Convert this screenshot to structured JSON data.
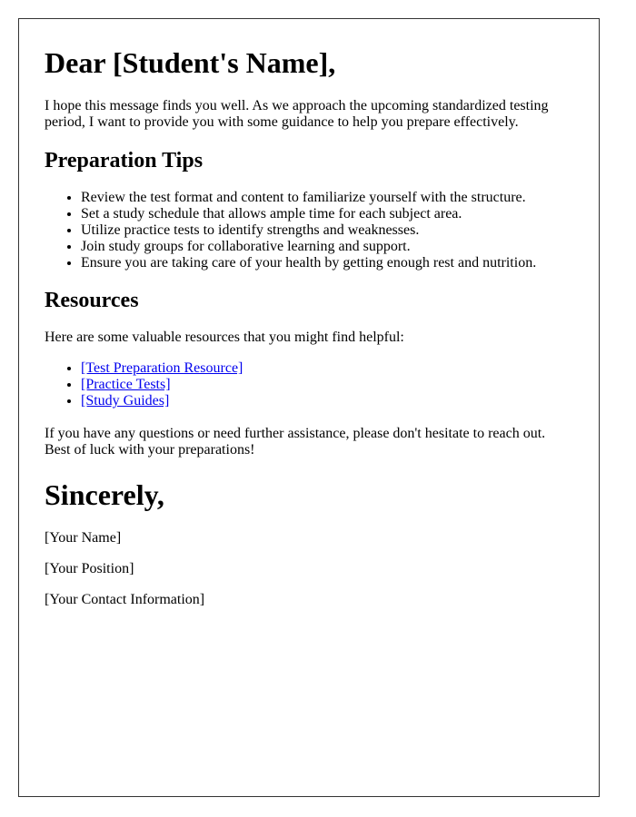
{
  "letter": {
    "greeting": "Dear [Student's Name],",
    "intro": "I hope this message finds you well. As we approach the upcoming standardized testing period, I want to provide you with some guidance to help you prepare effectively.",
    "tips_heading": "Preparation Tips",
    "tips": [
      "Review the test format and content to familiarize yourself with the structure.",
      "Set a study schedule that allows ample time for each subject area.",
      "Utilize practice tests to identify strengths and weaknesses.",
      "Join study groups for collaborative learning and support.",
      "Ensure you are taking care of your health by getting enough rest and nutrition."
    ],
    "resources_heading": "Resources",
    "resources_intro": "Here are some valuable resources that you might find helpful:",
    "resources": [
      "[Test Preparation Resource]",
      "[Practice Tests]",
      "[Study Guides]"
    ],
    "closing_paragraph": "If you have any questions or need further assistance, please don't hesitate to reach out. Best of luck with your preparations!",
    "sign_off": "Sincerely,",
    "signature": {
      "name": "[Your Name]",
      "position": "[Your Position]",
      "contact": "[Your Contact Information]"
    }
  },
  "colors": {
    "link": "#0000ee",
    "border": "#333333"
  }
}
